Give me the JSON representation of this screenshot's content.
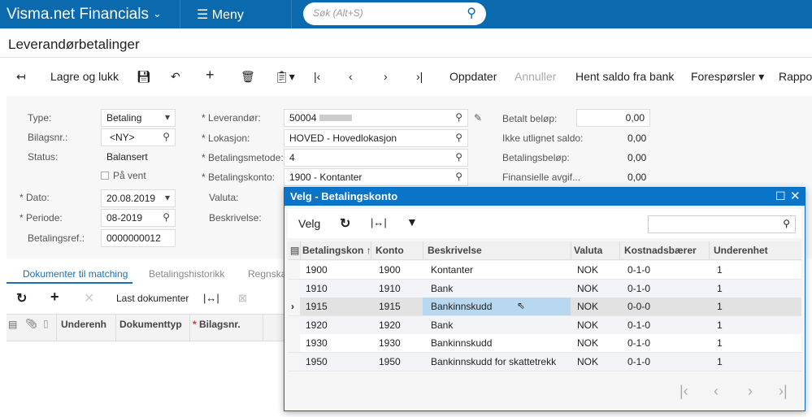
{
  "topbar": {
    "app": "Visma.net Financials",
    "menu": "Meny",
    "search_placeholder": "Søk (Alt+S)"
  },
  "page_title": "Leverandørbetalinger",
  "toolbar": {
    "save_close": "Lagre og lukk",
    "refresh": "Oppdater",
    "cancel": "Annuller",
    "fetch_balance": "Hent saldo fra bank",
    "inquiries": "Forespørsler",
    "reports": "Rappo"
  },
  "form": {
    "type_label": "Type:",
    "type_value": "Betaling",
    "bilag_label": "Bilagsnr.:",
    "bilag_value": "<NY>",
    "status_label": "Status:",
    "status_value": "Balansert",
    "hold_label": "På vent",
    "date_label": "Dato:",
    "date_value": "20.08.2019",
    "period_label": "Periode:",
    "period_value": "08-2019",
    "ref_label": "Betalingsref.:",
    "ref_value": "0000000012",
    "vendor_label": "Leverandør:",
    "vendor_value": "50004",
    "location_label": "Lokasjon:",
    "location_value": "HOVED - Hovedlokasjon",
    "method_label": "Betalingsmetode:",
    "method_value": "4",
    "account_label": "Betalingskonto:",
    "account_value": "1900 - Kontanter",
    "currency_label": "Valuta:",
    "desc_label": "Beskrivelse:",
    "paid_label": "Betalt beløp:",
    "paid_value": "0,00",
    "unapplied_label": "Ikke utlignet saldo:",
    "unapplied_value": "0,00",
    "payment_label": "Betalingsbeløp:",
    "payment_value": "0,00",
    "fees_label": "Finansielle avgif...",
    "fees_value": "0,00"
  },
  "tabs": [
    "Dokumenter til matching",
    "Betalingshistorikk",
    "Regnska"
  ],
  "grid": {
    "load_docs": "Last dokumenter",
    "columns": [
      "Underenh",
      "Dokumenttyp",
      "Bilagsnr."
    ]
  },
  "popup": {
    "title": "Velg - Betalingskonto",
    "select": "Velg",
    "columns": [
      "Betalingskon",
      "Konto",
      "Beskrivelse",
      "Valuta",
      "Kostnadsbærer",
      "Underenhet"
    ],
    "rows": [
      [
        "1900",
        "1900",
        "Kontanter",
        "NOK",
        "0-1-0",
        "1"
      ],
      [
        "1910",
        "1910",
        "Bank",
        "NOK",
        "0-1-0",
        "1"
      ],
      [
        "1915",
        "1915",
        "Bankinnskudd",
        "NOK",
        "0-0-0",
        "1"
      ],
      [
        "1920",
        "1920",
        "Bank",
        "NOK",
        "0-1-0",
        "1"
      ],
      [
        "1930",
        "1930",
        "Bankinnskudd",
        "NOK",
        "0-1-0",
        "1"
      ],
      [
        "1950",
        "1950",
        "Bankinnskudd for skattetrekk",
        "NOK",
        "0-1-0",
        "1"
      ]
    ],
    "selected_row": 2
  }
}
